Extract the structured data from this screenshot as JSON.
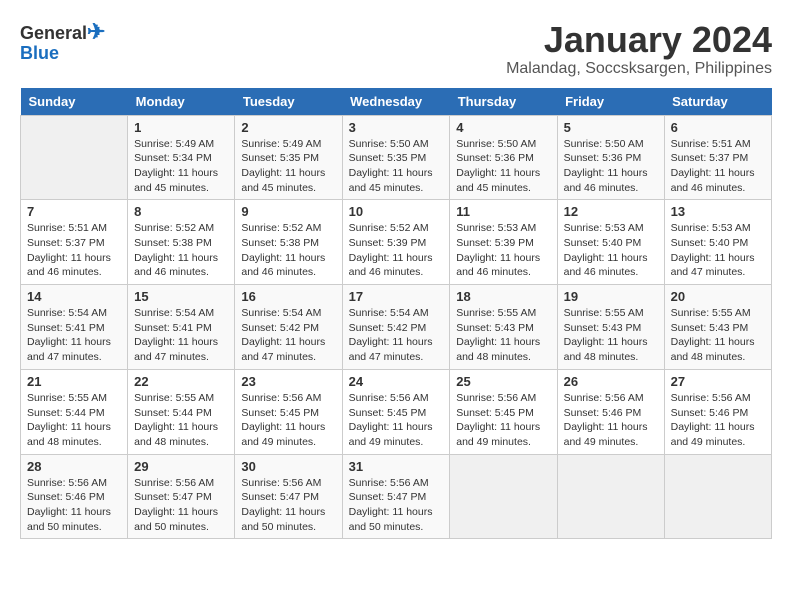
{
  "header": {
    "logo_general": "General",
    "logo_blue": "Blue",
    "title": "January 2024",
    "subtitle": "Malandag, Soccsksargen, Philippines"
  },
  "days_of_week": [
    "Sunday",
    "Monday",
    "Tuesday",
    "Wednesday",
    "Thursday",
    "Friday",
    "Saturday"
  ],
  "weeks": [
    [
      {
        "day": "",
        "sunrise": "",
        "sunset": "",
        "daylight": ""
      },
      {
        "day": "1",
        "sunrise": "Sunrise: 5:49 AM",
        "sunset": "Sunset: 5:34 PM",
        "daylight": "Daylight: 11 hours and 45 minutes."
      },
      {
        "day": "2",
        "sunrise": "Sunrise: 5:49 AM",
        "sunset": "Sunset: 5:35 PM",
        "daylight": "Daylight: 11 hours and 45 minutes."
      },
      {
        "day": "3",
        "sunrise": "Sunrise: 5:50 AM",
        "sunset": "Sunset: 5:35 PM",
        "daylight": "Daylight: 11 hours and 45 minutes."
      },
      {
        "day": "4",
        "sunrise": "Sunrise: 5:50 AM",
        "sunset": "Sunset: 5:36 PM",
        "daylight": "Daylight: 11 hours and 45 minutes."
      },
      {
        "day": "5",
        "sunrise": "Sunrise: 5:50 AM",
        "sunset": "Sunset: 5:36 PM",
        "daylight": "Daylight: 11 hours and 46 minutes."
      },
      {
        "day": "6",
        "sunrise": "Sunrise: 5:51 AM",
        "sunset": "Sunset: 5:37 PM",
        "daylight": "Daylight: 11 hours and 46 minutes."
      }
    ],
    [
      {
        "day": "7",
        "sunrise": "Sunrise: 5:51 AM",
        "sunset": "Sunset: 5:37 PM",
        "daylight": "Daylight: 11 hours and 46 minutes."
      },
      {
        "day": "8",
        "sunrise": "Sunrise: 5:52 AM",
        "sunset": "Sunset: 5:38 PM",
        "daylight": "Daylight: 11 hours and 46 minutes."
      },
      {
        "day": "9",
        "sunrise": "Sunrise: 5:52 AM",
        "sunset": "Sunset: 5:38 PM",
        "daylight": "Daylight: 11 hours and 46 minutes."
      },
      {
        "day": "10",
        "sunrise": "Sunrise: 5:52 AM",
        "sunset": "Sunset: 5:39 PM",
        "daylight": "Daylight: 11 hours and 46 minutes."
      },
      {
        "day": "11",
        "sunrise": "Sunrise: 5:53 AM",
        "sunset": "Sunset: 5:39 PM",
        "daylight": "Daylight: 11 hours and 46 minutes."
      },
      {
        "day": "12",
        "sunrise": "Sunrise: 5:53 AM",
        "sunset": "Sunset: 5:40 PM",
        "daylight": "Daylight: 11 hours and 46 minutes."
      },
      {
        "day": "13",
        "sunrise": "Sunrise: 5:53 AM",
        "sunset": "Sunset: 5:40 PM",
        "daylight": "Daylight: 11 hours and 47 minutes."
      }
    ],
    [
      {
        "day": "14",
        "sunrise": "Sunrise: 5:54 AM",
        "sunset": "Sunset: 5:41 PM",
        "daylight": "Daylight: 11 hours and 47 minutes."
      },
      {
        "day": "15",
        "sunrise": "Sunrise: 5:54 AM",
        "sunset": "Sunset: 5:41 PM",
        "daylight": "Daylight: 11 hours and 47 minutes."
      },
      {
        "day": "16",
        "sunrise": "Sunrise: 5:54 AM",
        "sunset": "Sunset: 5:42 PM",
        "daylight": "Daylight: 11 hours and 47 minutes."
      },
      {
        "day": "17",
        "sunrise": "Sunrise: 5:54 AM",
        "sunset": "Sunset: 5:42 PM",
        "daylight": "Daylight: 11 hours and 47 minutes."
      },
      {
        "day": "18",
        "sunrise": "Sunrise: 5:55 AM",
        "sunset": "Sunset: 5:43 PM",
        "daylight": "Daylight: 11 hours and 48 minutes."
      },
      {
        "day": "19",
        "sunrise": "Sunrise: 5:55 AM",
        "sunset": "Sunset: 5:43 PM",
        "daylight": "Daylight: 11 hours and 48 minutes."
      },
      {
        "day": "20",
        "sunrise": "Sunrise: 5:55 AM",
        "sunset": "Sunset: 5:43 PM",
        "daylight": "Daylight: 11 hours and 48 minutes."
      }
    ],
    [
      {
        "day": "21",
        "sunrise": "Sunrise: 5:55 AM",
        "sunset": "Sunset: 5:44 PM",
        "daylight": "Daylight: 11 hours and 48 minutes."
      },
      {
        "day": "22",
        "sunrise": "Sunrise: 5:55 AM",
        "sunset": "Sunset: 5:44 PM",
        "daylight": "Daylight: 11 hours and 48 minutes."
      },
      {
        "day": "23",
        "sunrise": "Sunrise: 5:56 AM",
        "sunset": "Sunset: 5:45 PM",
        "daylight": "Daylight: 11 hours and 49 minutes."
      },
      {
        "day": "24",
        "sunrise": "Sunrise: 5:56 AM",
        "sunset": "Sunset: 5:45 PM",
        "daylight": "Daylight: 11 hours and 49 minutes."
      },
      {
        "day": "25",
        "sunrise": "Sunrise: 5:56 AM",
        "sunset": "Sunset: 5:45 PM",
        "daylight": "Daylight: 11 hours and 49 minutes."
      },
      {
        "day": "26",
        "sunrise": "Sunrise: 5:56 AM",
        "sunset": "Sunset: 5:46 PM",
        "daylight": "Daylight: 11 hours and 49 minutes."
      },
      {
        "day": "27",
        "sunrise": "Sunrise: 5:56 AM",
        "sunset": "Sunset: 5:46 PM",
        "daylight": "Daylight: 11 hours and 49 minutes."
      }
    ],
    [
      {
        "day": "28",
        "sunrise": "Sunrise: 5:56 AM",
        "sunset": "Sunset: 5:46 PM",
        "daylight": "Daylight: 11 hours and 50 minutes."
      },
      {
        "day": "29",
        "sunrise": "Sunrise: 5:56 AM",
        "sunset": "Sunset: 5:47 PM",
        "daylight": "Daylight: 11 hours and 50 minutes."
      },
      {
        "day": "30",
        "sunrise": "Sunrise: 5:56 AM",
        "sunset": "Sunset: 5:47 PM",
        "daylight": "Daylight: 11 hours and 50 minutes."
      },
      {
        "day": "31",
        "sunrise": "Sunrise: 5:56 AM",
        "sunset": "Sunset: 5:47 PM",
        "daylight": "Daylight: 11 hours and 50 minutes."
      },
      {
        "day": "",
        "sunrise": "",
        "sunset": "",
        "daylight": ""
      },
      {
        "day": "",
        "sunrise": "",
        "sunset": "",
        "daylight": ""
      },
      {
        "day": "",
        "sunrise": "",
        "sunset": "",
        "daylight": ""
      }
    ]
  ]
}
